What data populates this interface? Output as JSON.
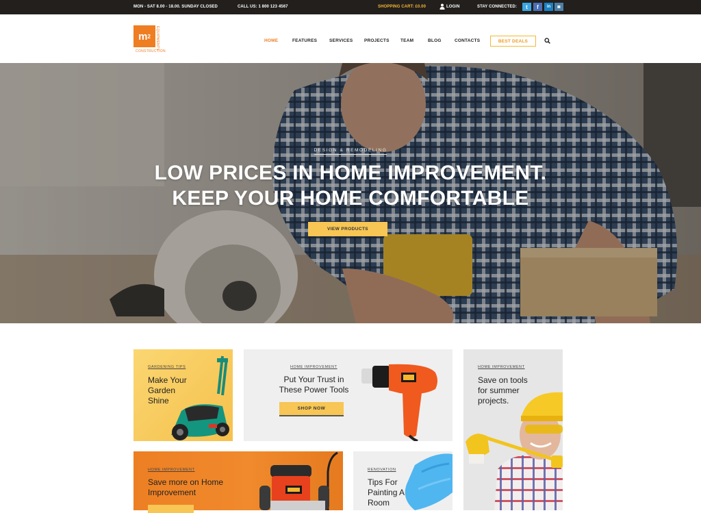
{
  "topbar": {
    "hours": "MON - SAT 8.00 - 18.00. SUNDAY CLOSED",
    "phone": "CALL US: 1 800 123 4567",
    "cart": "SHOPPING CART: £0.00",
    "login": "LOGIN",
    "stay_connected": "STAY CONNECTED:",
    "social": [
      {
        "name": "twitter",
        "glyph": "t",
        "color": "#3ba7e2"
      },
      {
        "name": "facebook",
        "glyph": "f",
        "color": "#4a6fb5"
      },
      {
        "name": "linkedin",
        "glyph": "in",
        "color": "#1a82c3"
      },
      {
        "name": "instagram",
        "glyph": "◙",
        "color": "#4d7fa6"
      }
    ]
  },
  "logo": {
    "mark": "m",
    "sup": "2",
    "side_text": "EQUIPMENTS",
    "under_text": "CONSTRUCTION",
    "color": "#ef7d22"
  },
  "nav": {
    "items": [
      {
        "label": "HOME",
        "active": true
      },
      {
        "label": "FEATURES",
        "active": false
      },
      {
        "label": "SERVICES",
        "active": false
      },
      {
        "label": "PROJECTS",
        "active": false
      },
      {
        "label": "TEAM",
        "active": false
      },
      {
        "label": "BLOG",
        "active": false
      },
      {
        "label": "CONTACTS",
        "active": false
      }
    ],
    "cta": "BEST DEALS",
    "search_icon": "search-icon"
  },
  "hero": {
    "kicker": "DESIGN & REMODELING",
    "title_line1": "LOW PRICES IN HOME IMPROVEMENT.",
    "title_line2": "KEEP YOUR HOME COMFORTABLE",
    "button": "VIEW PRODUCTS"
  },
  "promos": [
    {
      "tag": "GARDENING TIPS",
      "title": "Make Your Garden Shine"
    },
    {
      "tag": "HOME IMPROVEMENT",
      "title": "Put Your Trust in These Power Tools",
      "button": "SHOP NOW"
    },
    {
      "tag": "HOME IMPROVEMENT",
      "title": "Save on tools for summer projects."
    },
    {
      "tag": "HOME IMPROVEMENT",
      "title": "Save more on Home Improvement"
    },
    {
      "tag": "RENOVATION",
      "title": "Tips For Painting A Room"
    }
  ],
  "colors": {
    "accent_orange": "#ef7d22",
    "accent_yellow": "#f7c654",
    "topbar_bg": "#221f1d"
  }
}
